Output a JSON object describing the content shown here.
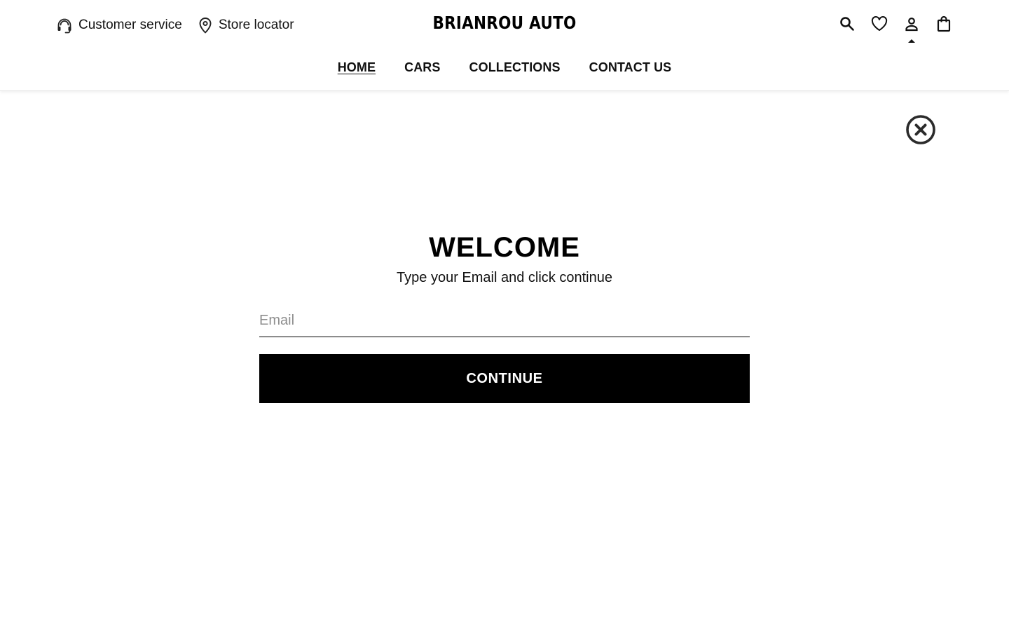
{
  "header": {
    "customer_service_label": "Customer service",
    "store_locator_label": "Store locator",
    "brand_name": "BRIANROU AUTO",
    "nav": {
      "home": "HOME",
      "cars": "CARS",
      "collections": "COLLECTIONS",
      "contact": "CONTACT US"
    },
    "active_nav": "HOME",
    "icons": [
      "headset-icon",
      "map-pin-icon",
      "search-icon",
      "heart-icon",
      "user-icon",
      "shopping-bag-icon"
    ]
  },
  "modal": {
    "close_icon": "close-circle-icon",
    "title": "WELCOME",
    "subtitle": "Type your Email and click continue",
    "email_placeholder": "Email",
    "email_value": "",
    "continue_label": "CONTINUE"
  },
  "colors": {
    "primary": "#000000",
    "background": "#ffffff",
    "placeholder": "#8e8e8e"
  }
}
